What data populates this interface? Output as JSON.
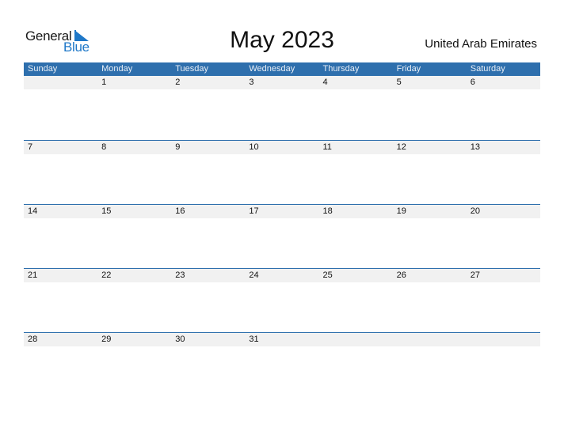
{
  "logo": {
    "general": "General",
    "blue": "Blue"
  },
  "title": "May 2023",
  "country": "United Arab Emirates",
  "colors": {
    "header_bg": "#2e6fad",
    "logo_blue": "#1f78c8",
    "row_band": "#f1f1f1"
  },
  "weekdays": [
    "Sunday",
    "Monday",
    "Tuesday",
    "Wednesday",
    "Thursday",
    "Friday",
    "Saturday"
  ],
  "weeks": [
    [
      "",
      "1",
      "2",
      "3",
      "4",
      "5",
      "6"
    ],
    [
      "7",
      "8",
      "9",
      "10",
      "11",
      "12",
      "13"
    ],
    [
      "14",
      "15",
      "16",
      "17",
      "18",
      "19",
      "20"
    ],
    [
      "21",
      "22",
      "23",
      "24",
      "25",
      "26",
      "27"
    ],
    [
      "28",
      "29",
      "30",
      "31",
      "",
      "",
      ""
    ]
  ]
}
